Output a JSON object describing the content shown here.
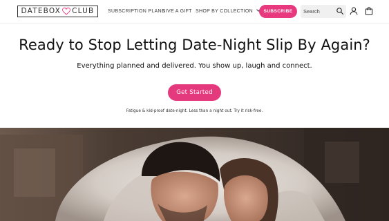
{
  "header": {
    "logo": {
      "left_text": "DATEBOX",
      "right_text": "CLUB",
      "icon": "heart-icon"
    },
    "nav": [
      {
        "label": "SUBSCRIPTION PLANS"
      },
      {
        "label": "GIVE A GIFT"
      },
      {
        "label": "SHOP BY COLLECTION",
        "icon": "chevron-down-icon"
      }
    ],
    "subscribe_label": "SUBSCRIBE",
    "search": {
      "placeholder": "Search",
      "value": "",
      "icon": "search-icon"
    },
    "account_icon": "user-icon",
    "cart_icon": "shopping-bag-icon"
  },
  "hero": {
    "headline": "Ready to Stop Letting Date-Night Slip By Again?",
    "subheadline": "Everything planned and delivered. You show up, laugh and connect.",
    "cta_label": "Get Started",
    "note": "Fatigue & kid-proof date-night. Less than a night out. Try it risk-free."
  },
  "colors": {
    "accent": "#e5397d",
    "logo_heart": "#e8397f",
    "text": "#111111",
    "search_bg": "#f0f0f0"
  }
}
